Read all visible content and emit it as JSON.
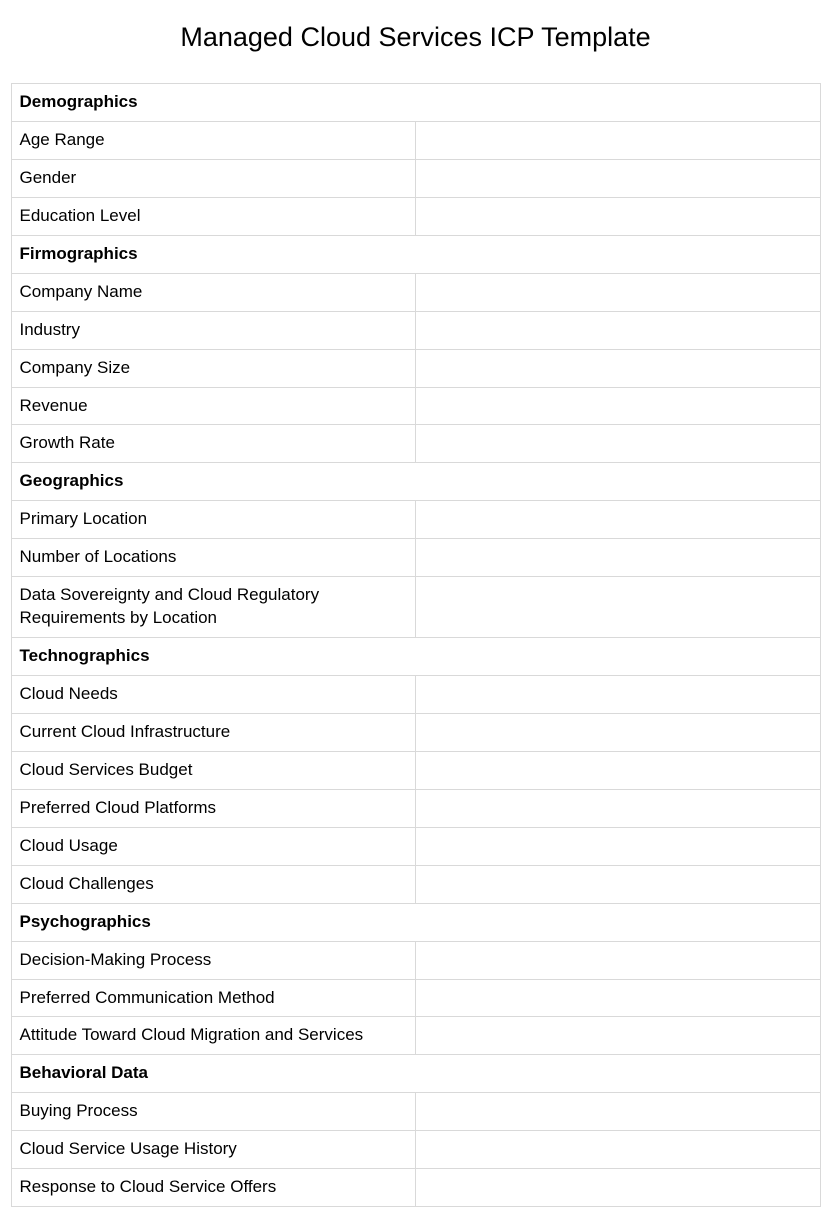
{
  "title": "Managed Cloud Services ICP Template",
  "sections": [
    {
      "header": "Demographics",
      "rows": [
        {
          "label": "Age Range",
          "value": ""
        },
        {
          "label": "Gender",
          "value": ""
        },
        {
          "label": "Education Level",
          "value": ""
        }
      ]
    },
    {
      "header": "Firmographics",
      "rows": [
        {
          "label": "Company Name",
          "value": ""
        },
        {
          "label": "Industry",
          "value": ""
        },
        {
          "label": "Company Size",
          "value": ""
        },
        {
          "label": "Revenue",
          "value": ""
        },
        {
          "label": "Growth Rate",
          "value": ""
        }
      ]
    },
    {
      "header": "Geographics",
      "rows": [
        {
          "label": "Primary Location",
          "value": ""
        },
        {
          "label": "Number of Locations",
          "value": ""
        },
        {
          "label": "Data Sovereignty and Cloud Regulatory Requirements by Location",
          "value": ""
        }
      ]
    },
    {
      "header": "Technographics",
      "rows": [
        {
          "label": "Cloud Needs",
          "value": ""
        },
        {
          "label": "Current Cloud Infrastructure",
          "value": ""
        },
        {
          "label": "Cloud Services Budget",
          "value": ""
        },
        {
          "label": "Preferred Cloud Platforms",
          "value": ""
        },
        {
          "label": "Cloud Usage",
          "value": ""
        },
        {
          "label": "Cloud Challenges",
          "value": ""
        }
      ]
    },
    {
      "header": "Psychographics",
      "rows": [
        {
          "label": "Decision-Making Process",
          "value": ""
        },
        {
          "label": "Preferred Communication Method",
          "value": ""
        },
        {
          "label": "Attitude Toward Cloud Migration and Services",
          "value": ""
        }
      ]
    },
    {
      "header": "Behavioral Data",
      "rows": [
        {
          "label": "Buying Process",
          "value": ""
        },
        {
          "label": "Cloud Service Usage History",
          "value": ""
        },
        {
          "label": "Response to Cloud Service Offers",
          "value": ""
        }
      ]
    }
  ]
}
